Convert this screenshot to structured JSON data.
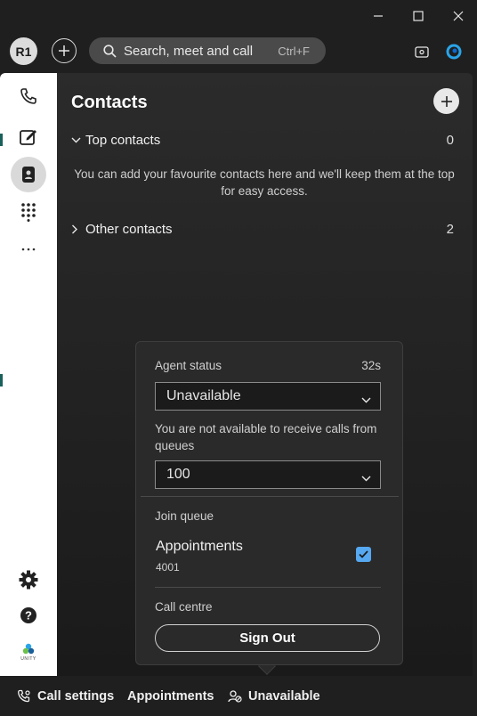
{
  "window": {
    "minimize_icon": "minimize-icon",
    "maximize_icon": "maximize-icon",
    "close_icon": "close-icon"
  },
  "topbar": {
    "avatar_initials": "R1",
    "search_placeholder": "Search, meet and call",
    "search_shortcut": "Ctrl+F"
  },
  "nav": {
    "items": [
      "phone-icon",
      "compose-icon",
      "contacts-icon",
      "dialpad-icon",
      "more-icon"
    ],
    "active": "contacts-icon",
    "bottom_items": [
      "settings-icon",
      "help-icon",
      "unity-logo"
    ],
    "logo_text": "UNITY"
  },
  "contacts": {
    "title": "Contacts",
    "top_contacts": {
      "label": "Top contacts",
      "count": "0"
    },
    "empty_message": "You can add your favourite contacts here and we'll keep them at the top for easy access.",
    "other_contacts": {
      "label": "Other contacts",
      "count": "2"
    }
  },
  "agent_panel": {
    "status_label": "Agent status",
    "timer": "32s",
    "status_value": "Unavailable",
    "note": "You are not available to receive calls from queues",
    "reason_value": "100",
    "join_queue_label": "Join queue",
    "queue": {
      "name": "Appointments",
      "number": "4001",
      "checked": true
    },
    "call_centre_label": "Call centre",
    "sign_out_label": "Sign Out"
  },
  "bottombar": {
    "call_settings": "Call settings",
    "appointments": "Appointments",
    "status": "Unavailable"
  },
  "colors": {
    "accent": "#56a8f0",
    "background": "#1f1f1f",
    "nav_bg": "#ffffff"
  }
}
